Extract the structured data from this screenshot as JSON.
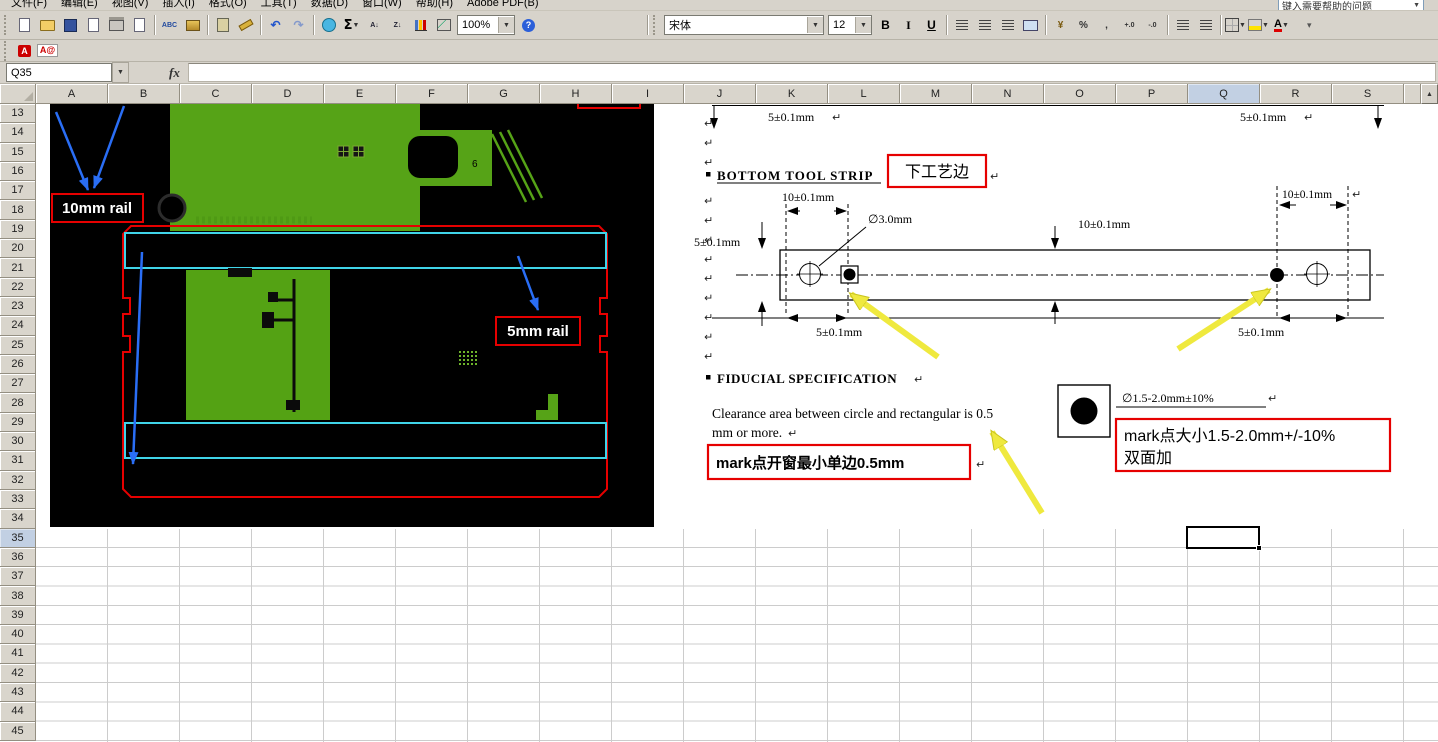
{
  "window": {
    "help_search": "键入需要帮助的问题"
  },
  "menu_bar": {
    "items": [
      "文件(F)",
      "编辑(E)",
      "视图(V)",
      "插入(I)",
      "格式(O)",
      "工具(T)",
      "数据(D)",
      "窗口(W)",
      "帮助(H)",
      "Adobe PDF(B)"
    ]
  },
  "toolbar": {
    "standard_icons": [
      "new-workbook",
      "open",
      "save",
      "permission",
      "print",
      "print-preview",
      "sep",
      "spelling",
      "research",
      "sep",
      "paste",
      "format-painter",
      "sep",
      "undo",
      "redo",
      "sep",
      "insert-hyperlink",
      "autosum",
      "sort-ascending",
      "sort-descending",
      "chart-wizard",
      "drawing"
    ],
    "zoom_value": "100%",
    "font_name": "宋体",
    "font_size": "12",
    "format_icons": [
      "bold",
      "italic",
      "underline",
      "sep",
      "align-left",
      "align-center",
      "align-right",
      "merge-center",
      "sep",
      "currency",
      "percent",
      "comma",
      "increase-decimal",
      "decrease-decimal",
      "sep",
      "decrease-indent",
      "increase-indent",
      "sep",
      "borders",
      "fill-color",
      "font-color"
    ],
    "pdf_icons": [
      "pdf-convert",
      "pdf-email"
    ]
  },
  "formula_bar": {
    "name_box": "Q35",
    "fx": "fx",
    "value": ""
  },
  "grid": {
    "columns": [
      "A",
      "B",
      "C",
      "D",
      "E",
      "F",
      "G",
      "H",
      "I",
      "J",
      "K",
      "L",
      "M",
      "N",
      "O",
      "P",
      "Q",
      "R",
      "S"
    ],
    "rows": [
      "13",
      "14",
      "15",
      "16",
      "17",
      "18",
      "19",
      "20",
      "21",
      "22",
      "23",
      "24",
      "25",
      "26",
      "27",
      "28",
      "29",
      "30",
      "31",
      "32",
      "33",
      "34",
      "35",
      "36",
      "37",
      "38",
      "39",
      "40",
      "41",
      "42",
      "43",
      "44",
      "45"
    ],
    "selected_column": "Q",
    "selected_row": "35",
    "selected_cell": "Q35"
  },
  "pcb": {
    "rail10_label": "10mm rail",
    "rail5_label": "5mm rail",
    "part_text": "6"
  },
  "drawing": {
    "top_left_dim": "5±0.1mm",
    "top_right_dim": "5±0.1mm",
    "bottom_tool_strip_title": "BOTTOM TOOL STRIP",
    "bottom_tool_strip_cn": "下工艺边",
    "dim_10_left": "10±0.1mm",
    "dim_10_right": "10±0.1mm",
    "dim_10_mid": "10±0.1mm",
    "dim_hole": "∅3.0mm",
    "dim_5_left": "5±0.1mm",
    "dim_5_bottom_left": "5±0.1mm",
    "dim_5_bottom_right": "5±0.1mm",
    "fiducial_title": "FIDUCIAL SPECIFICATION",
    "clearance_line1": "Clearance area between circle and rectangular is 0.5",
    "clearance_line2": "mm or more.",
    "mark_window_note": "mark点开窗最小单边0.5mm",
    "fiducial_size_dim": "∅1.5-2.0mm±10%",
    "mark_size_note_line1": "mark点大小1.5-2.0mm+/-10%",
    "mark_size_note_line2": "双面加",
    "return_mark": "↵",
    "return_mark_count": 13
  }
}
